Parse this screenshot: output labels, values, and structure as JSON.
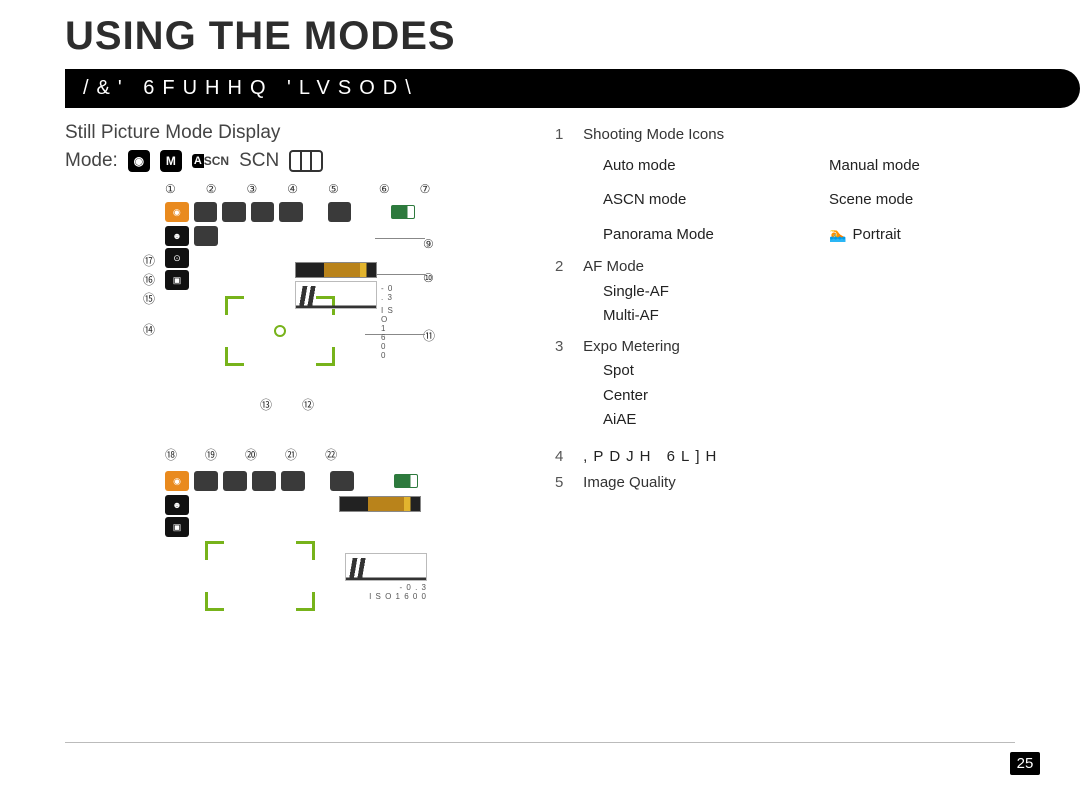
{
  "chapter_title": "USING THE MODES",
  "section_bar": "/&'  6FUHHQ  'LVSOD\\",
  "page_number": "25",
  "left": {
    "subhead": "Still Picture Mode Display",
    "mode_label": "Mode:",
    "scn_label": "SCN",
    "camera_box_glyph": "◉",
    "m_box_label": "M",
    "ascn_a": "A",
    "ascn_rest": "SCN",
    "top_callouts": [
      "①",
      "②",
      "③",
      "④",
      "⑤",
      "⑥",
      "⑦"
    ],
    "side_left": [
      "⑰",
      "⑯",
      "⑮",
      "⑭"
    ],
    "side_right": [
      "⑨",
      "⑩",
      "⑪"
    ],
    "below_callouts": [
      "⑬",
      "⑫"
    ],
    "second_top": [
      "⑱",
      "⑲",
      "⑳",
      "㉑",
      "㉒"
    ],
    "ev_text": "- 0 . 3",
    "iso_text": "I S O 1 6 0 0"
  },
  "right": {
    "item1_num": "1",
    "item1_head": "Shooting Mode Icons",
    "modes": {
      "auto": "Auto mode",
      "manual": "Manual mode",
      "ascn": "ASCN mode",
      "scene": "Scene mode",
      "pano": "Panorama Mode",
      "portrait": "Portrait"
    },
    "item2_num": "2",
    "item2_head": "AF Mode",
    "item2_a": "Single-AF",
    "item2_b": "Multi-AF",
    "item3_num": "3",
    "item3_head": "Expo Metering",
    "item3_a": "Spot",
    "item3_b": "Center",
    "item3_c": "AiAE",
    "item4_num": "4",
    "item4_head": ",PDJH  6L]H",
    "item5_num": "5",
    "item5_head": "Image Quality"
  }
}
